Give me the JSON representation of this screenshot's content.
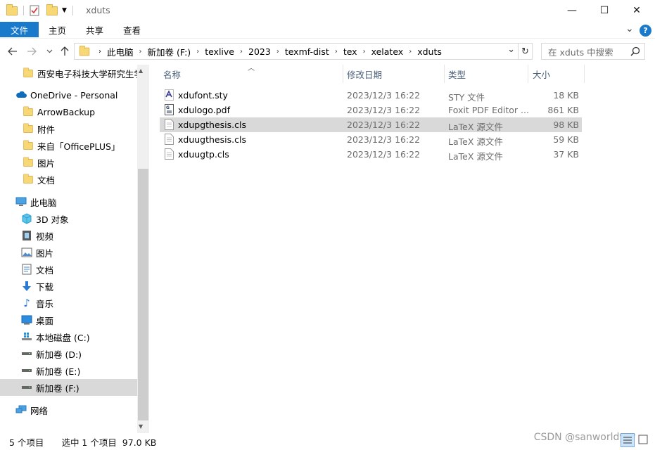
{
  "window": {
    "title": "xduts",
    "minimize": "—",
    "maximize": "☐",
    "close": "✕"
  },
  "ribbon": {
    "tabs": [
      "文件",
      "主页",
      "共享",
      "查看"
    ],
    "expand": "⌄",
    "help": "?"
  },
  "address": {
    "crumbs": [
      "此电脑",
      "新加卷 (F:)",
      "texlive",
      "2023",
      "texmf-dist",
      "tex",
      "xelatex",
      "xduts"
    ],
    "dropdown": "⌄",
    "refresh": "↻"
  },
  "search": {
    "placeholder": "在 xduts 中搜索"
  },
  "nav": {
    "items": [
      {
        "label": "西安电子科技大学研究生学",
        "icon": "folder-icon"
      },
      {
        "label": "OneDrive - Personal",
        "icon": "cloud-icon"
      },
      {
        "label": "ArrowBackup",
        "icon": "folder-icon"
      },
      {
        "label": "附件",
        "icon": "folder-icon"
      },
      {
        "label": "来自「OfficePLUS」",
        "icon": "folder-icon"
      },
      {
        "label": "图片",
        "icon": "folder-icon"
      },
      {
        "label": "文档",
        "icon": "folder-icon"
      },
      {
        "label": "此电脑",
        "icon": "computer-icon"
      },
      {
        "label": "3D 对象",
        "icon": "cube-icon"
      },
      {
        "label": "视频",
        "icon": "film-icon"
      },
      {
        "label": "图片",
        "icon": "picture-icon"
      },
      {
        "label": "文档",
        "icon": "document-icon"
      },
      {
        "label": "下载",
        "icon": "download-icon"
      },
      {
        "label": "音乐",
        "icon": "music-icon"
      },
      {
        "label": "桌面",
        "icon": "desktop-icon"
      },
      {
        "label": "本地磁盘 (C:)",
        "icon": "windows-drive-icon"
      },
      {
        "label": "新加卷 (D:)",
        "icon": "drive-icon"
      },
      {
        "label": "新加卷 (E:)",
        "icon": "drive-icon"
      },
      {
        "label": "新加卷 (F:)",
        "icon": "drive-icon"
      },
      {
        "label": "网络",
        "icon": "network-icon"
      }
    ]
  },
  "columns": {
    "name": "名称",
    "date": "修改日期",
    "type": "类型",
    "size": "大小"
  },
  "files": [
    {
      "name": "xdufont.sty",
      "date": "2023/12/3 16:22",
      "type": "STY 文件",
      "size": "18 KB",
      "icon": "sty-file-icon"
    },
    {
      "name": "xdulogo.pdf",
      "date": "2023/12/3 16:22",
      "type": "Foxit PDF Editor ...",
      "size": "861 KB",
      "icon": "pdf-file-icon"
    },
    {
      "name": "xdupgthesis.cls",
      "date": "2023/12/3 16:22",
      "type": "LaTeX 源文件",
      "size": "98 KB",
      "icon": "text-file-icon"
    },
    {
      "name": "xduugthesis.cls",
      "date": "2023/12/3 16:22",
      "type": "LaTeX 源文件",
      "size": "59 KB",
      "icon": "text-file-icon"
    },
    {
      "name": "xduugtp.cls",
      "date": "2023/12/3 16:22",
      "type": "LaTeX 源文件",
      "size": "37 KB",
      "icon": "text-file-icon"
    }
  ],
  "status": {
    "count": "5 个项目",
    "selection": "选中 1 个项目  97.0 KB"
  },
  "watermark": "CSDN @sanworldyar",
  "colors": {
    "accent": "#1979ca",
    "selection": "#d9d9d9",
    "header_text": "#4c607a"
  }
}
